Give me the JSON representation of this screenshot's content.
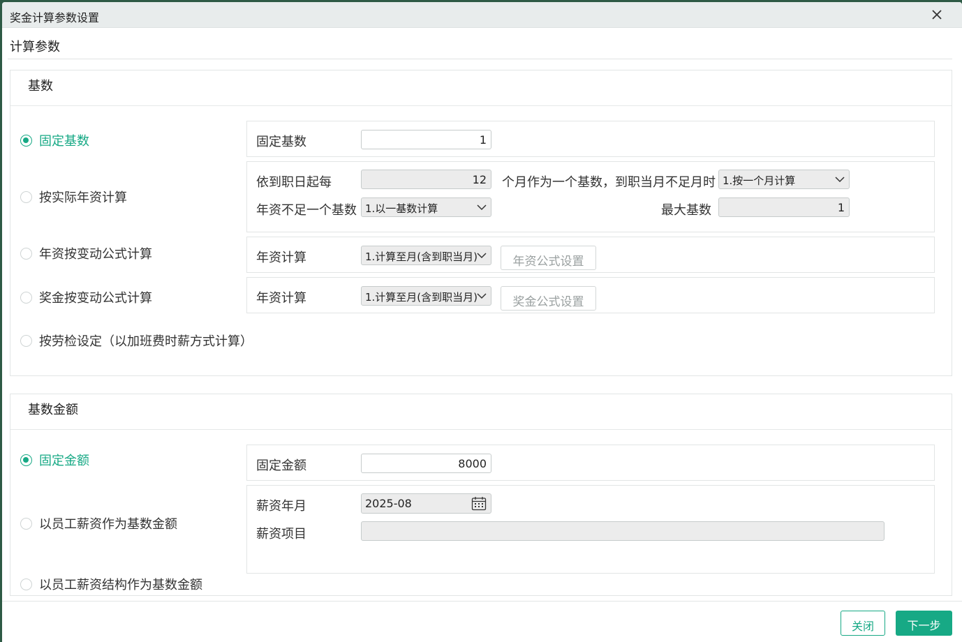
{
  "dialog": {
    "title": "奖金计算参数设置"
  },
  "tab": {
    "label": "计算参数"
  },
  "base_section": {
    "title": "基数",
    "options": [
      {
        "label": "固定基数",
        "selected": true
      },
      {
        "label": "按实际年资计算",
        "selected": false
      },
      {
        "label": "年资按变动公式计算",
        "selected": false
      },
      {
        "label": "奖金按变动公式计算",
        "selected": false
      },
      {
        "label": "按劳检设定（以加班费时薪方式计算）",
        "selected": false
      }
    ],
    "fixed": {
      "label": "固定基数",
      "value": "1"
    },
    "seniority": {
      "label_every": "依到职日起每",
      "months": "12",
      "label_months_suffix": "个月作为一个基数，到职当月不足月时",
      "partial_month_select": "1.按一个月计算",
      "label_insufficient": "年资不足一个基数",
      "insufficient_select": "1.以一基数计算",
      "label_max": "最大基数",
      "max_value": "1"
    },
    "seniority_formula": {
      "label": "年资计算",
      "select": "1.计算至月(含到职当月)",
      "button": "年资公式设置"
    },
    "bonus_formula": {
      "label": "年资计算",
      "select": "1.计算至月(含到职当月)",
      "button": "奖金公式设置"
    }
  },
  "amount_section": {
    "title": "基数金额",
    "options": [
      {
        "label": "固定金额",
        "selected": true
      },
      {
        "label": "以员工薪资作为基数金额",
        "selected": false
      },
      {
        "label": "以员工薪资结构作为基数金额",
        "selected": false
      }
    ],
    "fixed": {
      "label": "固定金额",
      "value": "8000"
    },
    "salary": {
      "label_month": "薪资年月",
      "month_value": "2025-08",
      "label_item": "薪资项目",
      "item_value": ""
    }
  },
  "footer": {
    "close_label": "关闭",
    "next_label": "下一步"
  },
  "colors": {
    "accent": "#17a985",
    "titlebar": "#e8ecec"
  }
}
